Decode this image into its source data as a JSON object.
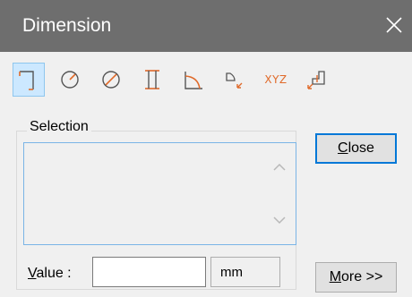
{
  "window": {
    "title": "Dimension",
    "close_glyph": "✕"
  },
  "toolbar": {
    "tools": [
      {
        "name": "linear-dimension-icon",
        "active": true
      },
      {
        "name": "radius-dimension-icon",
        "active": false
      },
      {
        "name": "diameter-dimension-icon",
        "active": false
      },
      {
        "name": "thickness-dimension-icon",
        "active": false
      },
      {
        "name": "angle-dimension-icon",
        "active": false
      },
      {
        "name": "fillet-dimension-icon",
        "active": false
      },
      {
        "name": "xyz-coordinate-icon",
        "label": "XYZ",
        "active": false
      },
      {
        "name": "ordinate-dimension-icon",
        "active": false
      }
    ],
    "accent_color": "#e06a2a",
    "active_bg": "#cce8ff"
  },
  "selection": {
    "label": "Selection",
    "items": []
  },
  "value": {
    "label_underlined": "V",
    "label_rest": "alue :",
    "input_value": "",
    "unit": "mm"
  },
  "buttons": {
    "close_underlined": "C",
    "close_rest": "lose",
    "more_underlined": "M",
    "more_rest": "ore >>"
  }
}
